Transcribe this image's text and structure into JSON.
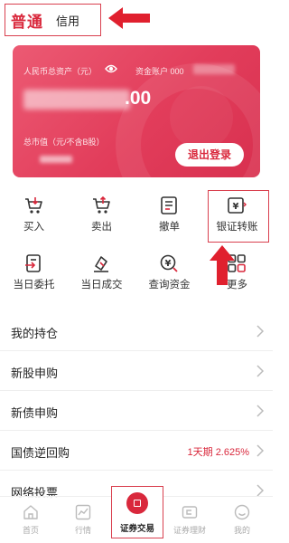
{
  "top_tabs": {
    "primary": "普通",
    "secondary": "信用"
  },
  "asset_card": {
    "assets_label": "人民币总资产（元）",
    "account_label": "资金账户 000",
    "total_assets_visible": ".00",
    "market_value_label": "总市值（元/不含B股）",
    "logout_label": "退出登录"
  },
  "functions": [
    {
      "label": "买入",
      "icon": "cart-in-icon"
    },
    {
      "label": "卖出",
      "icon": "cart-out-icon"
    },
    {
      "label": "撤单",
      "icon": "cancel-order-icon"
    },
    {
      "label": "银证转账",
      "icon": "bank-transfer-icon"
    },
    {
      "label": "当日委托",
      "icon": "today-order-icon"
    },
    {
      "label": "当日成交",
      "icon": "today-deal-icon"
    },
    {
      "label": "查询资金",
      "icon": "query-funds-icon"
    },
    {
      "label": "更多",
      "icon": "more-grid-icon"
    }
  ],
  "menu": [
    {
      "label": "我的持仓",
      "value": ""
    },
    {
      "label": "新股申购",
      "value": ""
    },
    {
      "label": "新债申购",
      "value": ""
    },
    {
      "label": "国债逆回购",
      "value": "1天期 2.625%"
    },
    {
      "label": "网络投票",
      "value": ""
    }
  ],
  "bottom_nav": [
    {
      "label": "首页",
      "icon": "home-icon"
    },
    {
      "label": "行情",
      "icon": "chart-icon"
    },
    {
      "label": "证券交易",
      "icon": "trade-icon",
      "active": true
    },
    {
      "label": "证券理财",
      "icon": "wallet-icon"
    },
    {
      "label": "我的",
      "icon": "profile-icon"
    }
  ],
  "colors": {
    "brand_red": "#d9283c",
    "card_gradient_start": "#ec5a73",
    "card_gradient_end": "#d8304f",
    "highlight_border": "#d9404f"
  }
}
